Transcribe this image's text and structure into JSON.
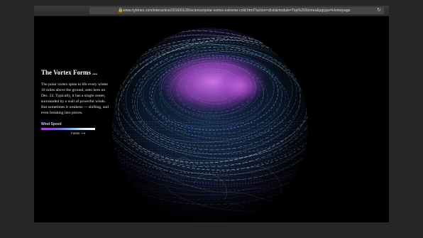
{
  "browser": {
    "url": "www.nytimes.com/interactive/2016/01/26/science/polar-vortex-extreme-cold.html?action=click&module=Top%20Stories&pgtype=Homepage",
    "icons": [
      "sidebar-icon",
      "lock-icon",
      "reload-icon"
    ]
  },
  "article": {
    "title": "The Vortex Forms ...",
    "body": "The polar vortex spins to life every winter 10 miles above the ground, seen here on Dec. 22. Typically, it has a single center, surrounded by a wall of powerful winds. But sometimes it weakens — shifting, and even breaking into pieces.",
    "legend": {
      "title": "Wind Speed",
      "faster_label": "Faster",
      "colors": [
        "#b43bd1",
        "#7b5bd8",
        "#70a4e5",
        "#c9e7f3",
        "#ffffff"
      ]
    }
  }
}
